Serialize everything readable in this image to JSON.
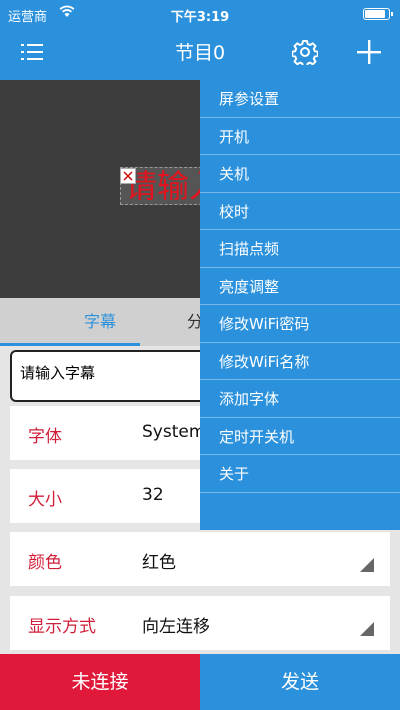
{
  "status_bar": {
    "carrier": "运营商",
    "time": "下午3:19"
  },
  "nav": {
    "title": "节目0",
    "icons": [
      "list-menu-icon",
      "gear-icon",
      "plus-icon"
    ]
  },
  "preview": {
    "text": "请输入字幕",
    "text_color": "#e0141e"
  },
  "tabs": [
    {
      "label": "字幕"
    },
    {
      "label": "分"
    }
  ],
  "subtitle_input": {
    "value": "请输入字幕"
  },
  "settings": [
    {
      "label": "字体",
      "value": "System"
    },
    {
      "label": "大小",
      "value": "32"
    },
    {
      "label": "颜色",
      "value": "红色"
    },
    {
      "label": "显示方式",
      "value": "向左连移"
    }
  ],
  "bottom": {
    "connect_label": "未连接",
    "send_label": "发送"
  },
  "dropdown": {
    "items": [
      "屏参设置",
      "开机",
      "关机",
      "校时",
      "扫描点频",
      "亮度调整",
      "修改WiFi密码",
      "修改WiFi名称",
      "添加字体",
      "定时开关机",
      "关于"
    ]
  },
  "colors": {
    "primary": "#2b91dc",
    "accent_red": "#e0193a",
    "label_red": "#d11f3a"
  }
}
